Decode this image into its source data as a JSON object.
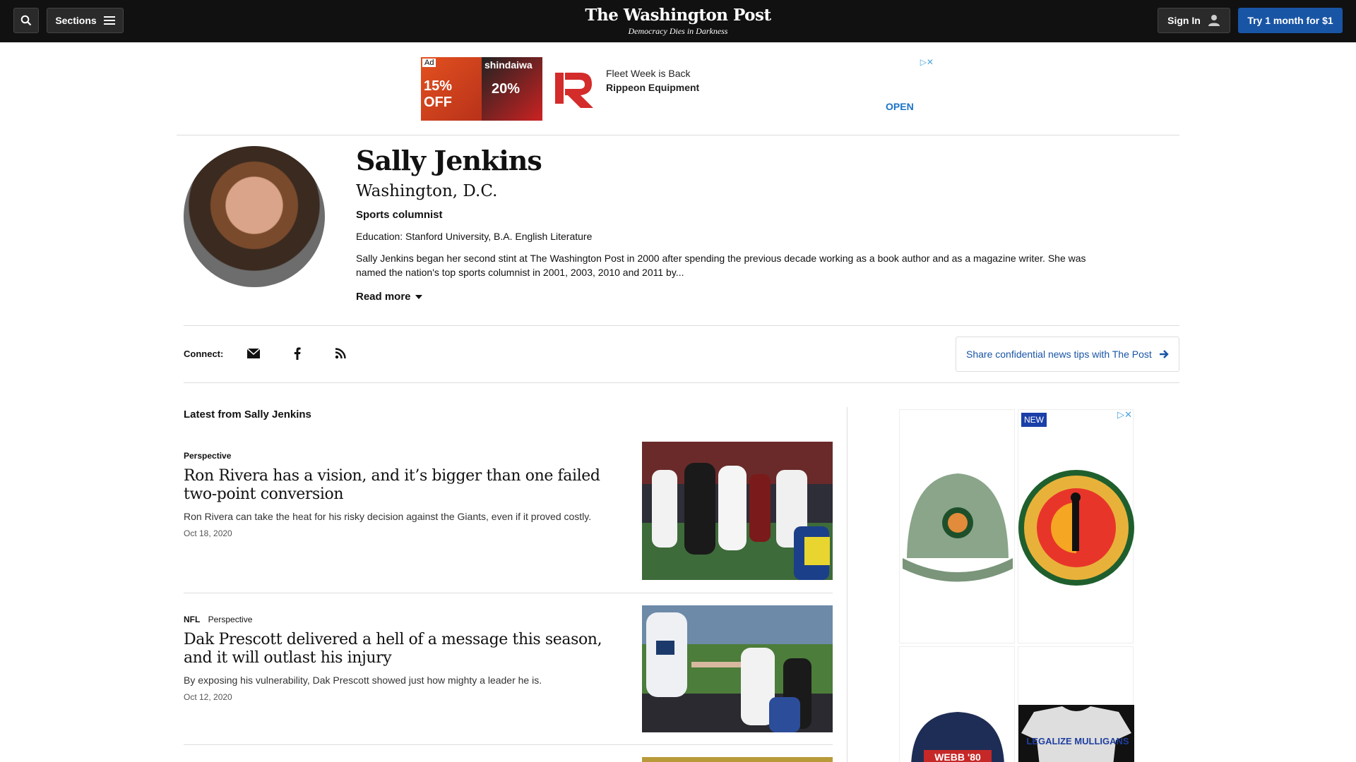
{
  "header": {
    "sections_label": "Sections",
    "logo": "The Washington Post",
    "tagline": "Democracy Dies in Darkness",
    "sign_in_label": "Sign In",
    "try_label": "Try 1 month for $1"
  },
  "top_ad": {
    "ad_tag": "Ad",
    "image_brand": "shindaiwa",
    "image_offer_1": "15% OFF",
    "image_offer_2": "20%",
    "line1": "Fleet Week is Back",
    "line2": "Rippeon Equipment",
    "cta": "OPEN"
  },
  "author": {
    "name": "Sally Jenkins",
    "location": "Washington, D.C.",
    "role": "Sports columnist",
    "education": "Education: Stanford University, B.A. English Literature",
    "bio": "Sally Jenkins began her second stint at The Washington Post in 2000 after spending the previous decade working as a book author and as a magazine writer. She was named the nation's top sports columnist in 2001, 2003, 2010 and 2011 by...",
    "read_more": "Read more"
  },
  "connect": {
    "label": "Connect:",
    "icons": [
      "email-icon",
      "facebook-icon",
      "rss-icon"
    ],
    "tips_label": "Share confidential news tips with The Post"
  },
  "feed": {
    "title": "Latest from Sally Jenkins",
    "articles": [
      {
        "section": "",
        "label": "Perspective",
        "headline": "Ron Rivera has a vision, and it’s bigger than one failed two-point conversion",
        "blurb": "Ron Rivera can take the heat for his risky decision against the Giants, even if it proved costly.",
        "date": "Oct 18, 2020"
      },
      {
        "section": "NFL",
        "label": "Perspective",
        "headline": "Dak Prescott delivered a hell of a message this season, and it will outlast his injury",
        "blurb": "By exposing his vulnerability, Dak Prescott showed just how mighty a leader he is.",
        "date": "Oct 12, 2020"
      }
    ]
  },
  "side_ad": {
    "badge": "NEW",
    "items": [
      "green-cap",
      "u-suck-at-golf-patch",
      "webb-80-cap",
      "legalize-mulligans-shirt"
    ],
    "cap_text": "WEBB '80",
    "shirt_text": "LEGALIZE MULLIGANS"
  },
  "colors": {
    "topbar": "#111111",
    "accent": "#1955a5",
    "link": "#1955a5"
  }
}
